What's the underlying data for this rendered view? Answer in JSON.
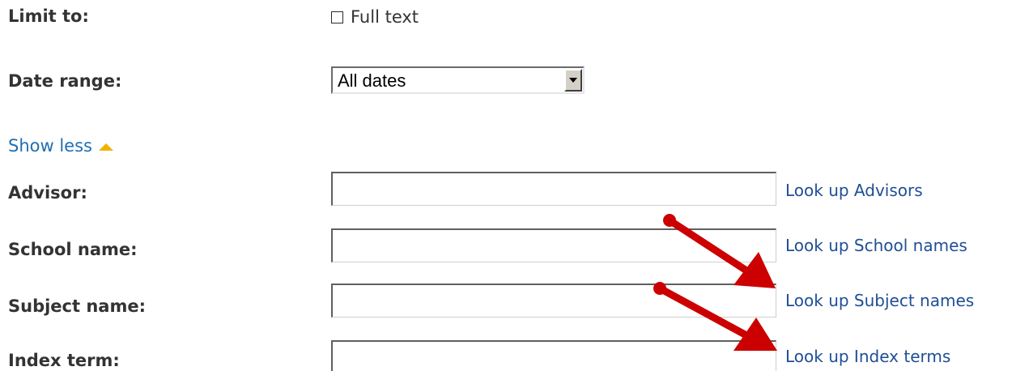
{
  "limit": {
    "label": "Limit to:",
    "fulltext_label": "Full text",
    "fulltext_checked": false
  },
  "date_range": {
    "label": "Date range:",
    "value": "All dates"
  },
  "show_less": {
    "label": "Show less"
  },
  "fields": {
    "advisor": {
      "label": "Advisor:",
      "value": "",
      "lookup": "Look up Advisors"
    },
    "school": {
      "label": "School name:",
      "value": "",
      "lookup": "Look up School names"
    },
    "subject": {
      "label": "Subject name:",
      "value": "",
      "lookup": "Look up Subject names"
    },
    "index": {
      "label": "Index term:",
      "value": "",
      "lookup": "Look up Index terms"
    }
  },
  "annotation": {
    "arrow_color": "#cc0000"
  }
}
